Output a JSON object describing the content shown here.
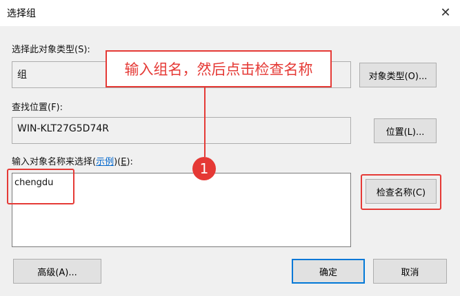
{
  "window": {
    "title": "选择组",
    "close_glyph": "✕"
  },
  "object_type": {
    "label": "选择此对象类型(S):",
    "value": "组",
    "button": "对象类型(O)..."
  },
  "location": {
    "label": "查找位置(F):",
    "value": "WIN-KLT27G5D74R",
    "button": "位置(L)..."
  },
  "names": {
    "label_prefix": "输入对象名称来选择(",
    "label_link": "示例",
    "label_middle": ")(",
    "label_key": "E",
    "label_suffix": "):",
    "value": "chengdu",
    "check_button": "检查名称(C)"
  },
  "footer": {
    "advanced_button": "高级(A)...",
    "ok_button": "确定",
    "cancel_button": "取消"
  },
  "annotation": {
    "text": "输入组名，然后点击检查名称",
    "step": "1",
    "color": "#e53935"
  },
  "colors": {
    "dialog_bg": "#f0f0f0",
    "button_bg": "#e1e1e1",
    "default_border": "#0078d7",
    "link": "#0066cc"
  }
}
